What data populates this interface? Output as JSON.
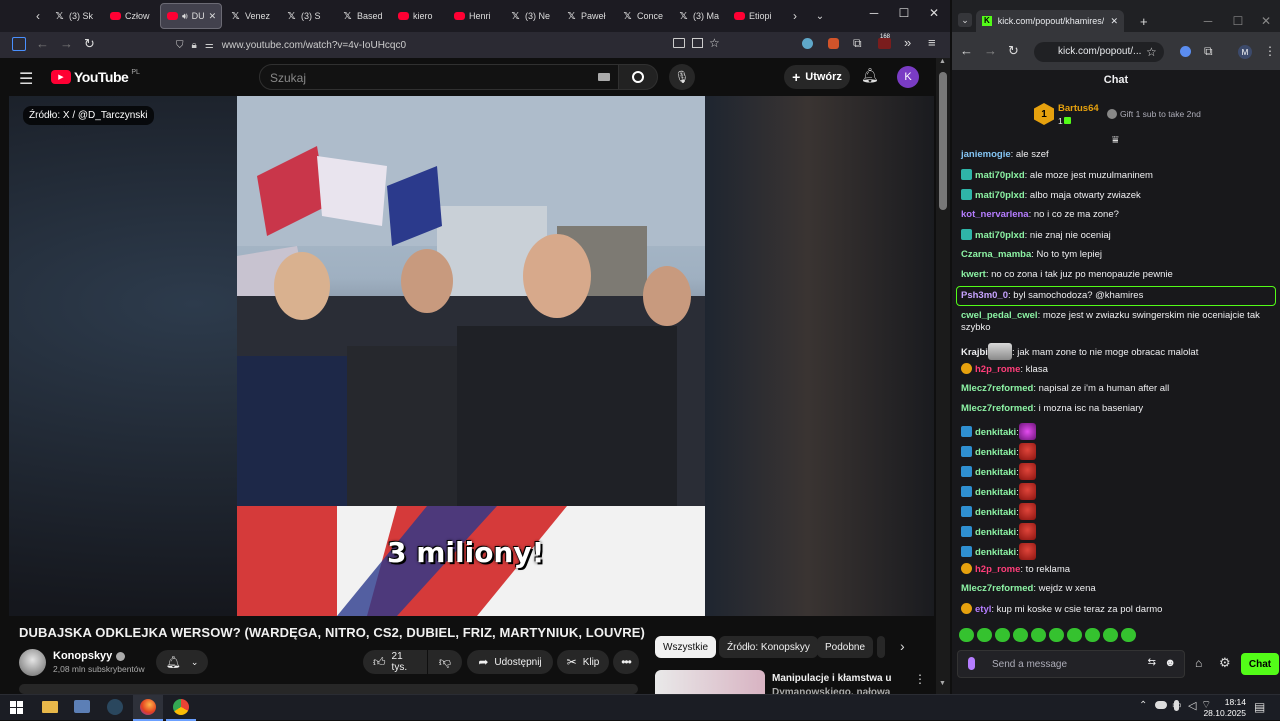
{
  "firefox": {
    "tabs": [
      {
        "label": "(3) Sk",
        "icon": "x"
      },
      {
        "label": "Człow",
        "icon": "yt"
      },
      {
        "label": "DU",
        "icon": "yt"
      },
      {
        "label": "Venez",
        "icon": "x"
      },
      {
        "label": "(3) S",
        "icon": "x"
      },
      {
        "label": "Based",
        "icon": "x"
      },
      {
        "label": "kiero",
        "icon": "yt"
      },
      {
        "label": "Henri",
        "icon": "yt"
      },
      {
        "label": "(3) Ne",
        "icon": "x"
      },
      {
        "label": "Paweł",
        "icon": "x"
      },
      {
        "label": "Conce",
        "icon": "x"
      },
      {
        "label": "(3) Ma",
        "icon": "x"
      },
      {
        "label": "Etiopi",
        "icon": "yt"
      }
    ],
    "url": "www.youtube.com/watch?v=4v-IoUHcqc0",
    "badge_count": "168"
  },
  "youtube": {
    "logo_text": "YouTube",
    "country": "PL",
    "search_placeholder": "Szukaj",
    "create_label": "Utwórz",
    "avatar_letter": "K",
    "video_source_overlay": "Źródło: X / @D_Tarczynski",
    "video_caption": "3 miliony!",
    "title": "DUBAJSKA ODKLEJKA WERSOW? (WARDĘGA, NITRO, CS2, DUBIEL, FRIZ, MARTYNIUK, LOUVRE)",
    "channel_name": "Konopskyy",
    "subscribers": "2,08 mln subskrybentów",
    "likes": "21 tys.",
    "share_label": "Udostępnij",
    "clip_label": "Klip",
    "chips": [
      "Wszystkie",
      "Źródło: Konopskyy",
      "Podobne"
    ],
    "next_video_title_1": "Manipulacje i kłamstwa u",
    "next_video_title_2": "Dymanowskiego, nałowa"
  },
  "chat_window": {
    "tab_title": "kick.com/popout/khamires/cha",
    "url": "kick.com/popout/...",
    "profile_letter": "M",
    "header": "Chat",
    "pinned_user": "Bartus64",
    "pinned_count": "1",
    "pinned_gift": "Gift 1 sub to take 2nd",
    "input_placeholder": "Send a message",
    "send_label": "Chat"
  },
  "chat_messages": [
    {
      "user": "janiemogie",
      "text": ": ale szef",
      "color": "#84c5f4",
      "badge": ""
    },
    {
      "user": "mati70plxd",
      "text": ": ale moze jest muzulmaninem",
      "color": "#8cf2a4",
      "badge": "#2fb5a8"
    },
    {
      "user": "mati70plxd",
      "text": ": albo maja otwarty zwiazek",
      "color": "#8cf2a4",
      "badge": "#2fb5a8"
    },
    {
      "user": "kot_nervarlena",
      "text": ": no i co ze ma zone?",
      "color": "#b57dff",
      "badge": ""
    },
    {
      "user": "mati70plxd",
      "text": ": nie znaj nie oceniaj",
      "color": "#8cf2a4",
      "badge": "#2fb5a8"
    },
    {
      "user": "Czarna_mamba",
      "text": ": No to tym lepiej",
      "color": "#8cf2a4",
      "badge": ""
    },
    {
      "user": "kwert",
      "text": ": no co zona i tak juz po menopauzie pewnie",
      "color": "#8cf2a4",
      "badge": ""
    },
    {
      "user": "Psh3m0_0",
      "text": ": byl samochodoza? @khamires",
      "color": "#c7a3ff",
      "badge": ""
    },
    {
      "user": "cwel_pedal_cwel",
      "text": ": moze jest w zwiazku swingerskim nie oceniajcie tak szybko",
      "color": "#8cf2a4",
      "badge": ""
    },
    {
      "user": "Krajbi",
      "text": ": jak mam zone to nie moge obracac malolat",
      "color": "#efeff1",
      "badge": ""
    },
    {
      "user": "h2p_rome",
      "text": ": klasa",
      "color": "#ff3e7a",
      "badge": "#e6a10e"
    },
    {
      "user": "Mlecz7reformed",
      "text": ": napisal ze i'm a human after all",
      "color": "#8cf2a4",
      "badge": ""
    },
    {
      "user": "Mlecz7reformed",
      "text": ": i mozna isc na baseniary",
      "color": "#8cf2a4",
      "badge": ""
    },
    {
      "user": "denkitaki",
      "text": ":",
      "color": "#8cf2a4",
      "badge": "#2f8fd0"
    },
    {
      "user": "denkitaki",
      "text": ":",
      "color": "#8cf2a4",
      "badge": "#2f8fd0"
    },
    {
      "user": "denkitaki",
      "text": ":",
      "color": "#8cf2a4",
      "badge": "#2f8fd0"
    },
    {
      "user": "denkitaki",
      "text": ":",
      "color": "#8cf2a4",
      "badge": "#2f8fd0"
    },
    {
      "user": "denkitaki",
      "text": ":",
      "color": "#8cf2a4",
      "badge": "#2f8fd0"
    },
    {
      "user": "denkitaki",
      "text": ":",
      "color": "#8cf2a4",
      "badge": "#2f8fd0"
    },
    {
      "user": "denkitaki",
      "text": ":",
      "color": "#8cf2a4",
      "badge": "#2f8fd0"
    },
    {
      "user": "h2p_rome",
      "text": ": to reklama",
      "color": "#ff3e7a",
      "badge": "#e6a10e"
    },
    {
      "user": "Mlecz7reformed",
      "text": ": wejdz w xena",
      "color": "#8cf2a4",
      "badge": ""
    },
    {
      "user": "etyl",
      "text": ": kup mi koske w csie teraz za pol darmo",
      "color": "#b57dff",
      "badge": "#e6a10e"
    }
  ],
  "taskbar": {
    "time": "18:14",
    "date": "28.10.2025"
  }
}
